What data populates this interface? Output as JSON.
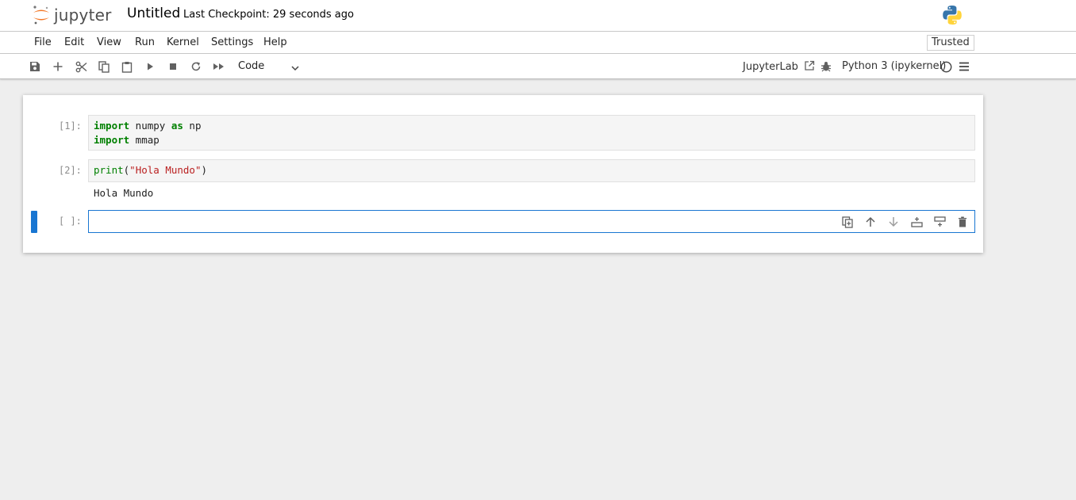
{
  "header": {
    "logo_text": "jupyter",
    "notebook_title": "Untitled",
    "checkpoint": "Last Checkpoint: 29 seconds ago"
  },
  "menubar": {
    "items": [
      "File",
      "Edit",
      "View",
      "Run",
      "Kernel",
      "Settings",
      "Help"
    ],
    "trusted_label": "Trusted"
  },
  "toolbar": {
    "icons": [
      "save-icon",
      "add-icon",
      "cut-icon",
      "copy-icon",
      "paste-icon",
      "run-icon",
      "stop-icon",
      "restart-icon",
      "fast-forward-icon"
    ],
    "cell_type": "Code",
    "jupyterlab_label": "JupyterLab",
    "kernel_name": "Python 3 (ipykernel)"
  },
  "cells": [
    {
      "prompt": "[1]:",
      "lines": [
        [
          {
            "t": "import",
            "c": "kw"
          },
          {
            "t": " numpy ",
            "c": "plain"
          },
          {
            "t": "as",
            "c": "kw"
          },
          {
            "t": " np",
            "c": "plain"
          }
        ],
        [
          {
            "t": "import",
            "c": "kw"
          },
          {
            "t": " mmap",
            "c": "plain"
          }
        ]
      ]
    },
    {
      "prompt": "[2]:",
      "lines": [
        [
          {
            "t": "print",
            "c": "fn"
          },
          {
            "t": "(",
            "c": "plain"
          },
          {
            "t": "\"Hola Mundo\"",
            "c": "str"
          },
          {
            "t": ")",
            "c": "plain"
          }
        ]
      ],
      "output": "Hola Mundo"
    },
    {
      "prompt": "[ ]:",
      "lines": []
    }
  ],
  "cell_tools": [
    "duplicate-cell-icon",
    "move-up-icon",
    "move-down-icon",
    "insert-above-icon",
    "insert-below-icon",
    "delete-cell-icon"
  ],
  "colors": {
    "accent": "#1976d2",
    "jupyter_orange": "#f37726",
    "keyword": "#008000",
    "string": "#ba2121"
  }
}
